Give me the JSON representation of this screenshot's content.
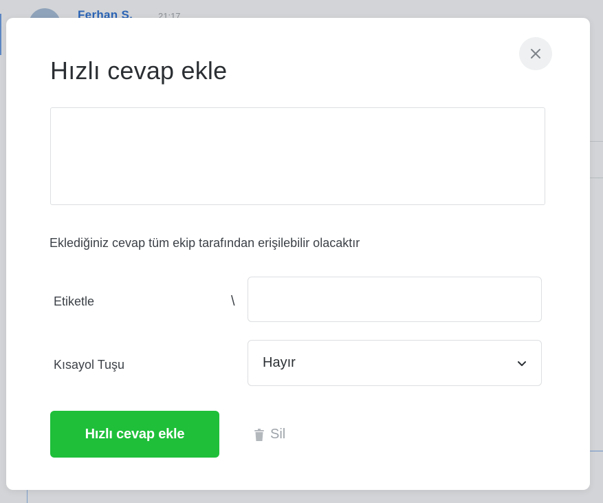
{
  "background": {
    "user_name": "Ferhan S.",
    "time": "21:17"
  },
  "modal": {
    "title": "Hızlı cevap ekle",
    "textarea_value": "",
    "info_text": "Eklediğiniz cevap tüm ekip tarafından erişilebilir olacaktır",
    "tag_label": "Etiketle",
    "tag_prefix": "\\",
    "tag_value": "",
    "shortcut_label": "Kısayol Tuşu",
    "shortcut_value": "Hayır",
    "submit_label": "Hızlı cevap ekle",
    "delete_label": "Sil",
    "close_icon": "close-icon",
    "chevron_icon": "chevron-down-icon",
    "trash_icon": "trash-icon"
  },
  "colors": {
    "primary_button": "#1fbf3a",
    "overlay": "#d2d4d7"
  }
}
